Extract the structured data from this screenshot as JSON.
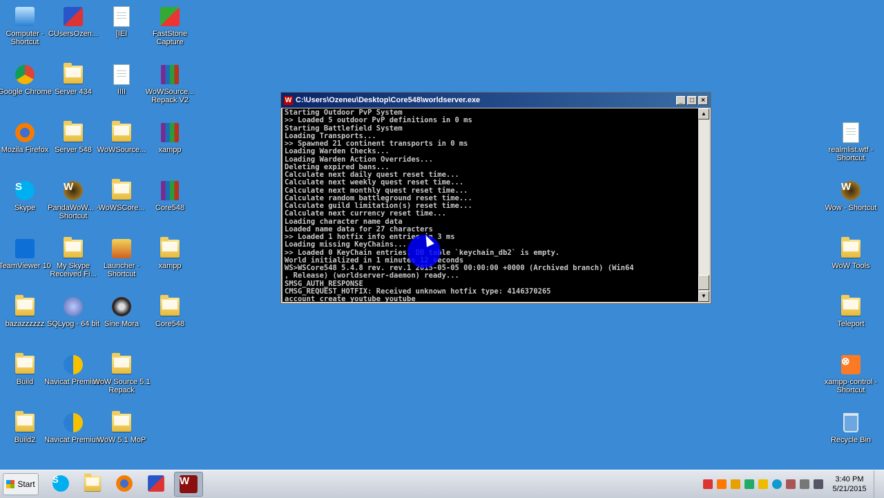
{
  "desktop_icons": [
    {
      "name": "desktop-icon-computer-shortcut",
      "label": "Computer - Shortcut",
      "icon": "computer-icon",
      "x": 0,
      "y": 0
    },
    {
      "name": "desktop-icon-cusersozen",
      "label": "CUsersOzen...",
      "icon": "triangle-app-icon"
    },
    {
      "name": "desktop-icon-iei",
      "label": "[IEI",
      "icon": "document-icon"
    },
    {
      "name": "desktop-icon-faststone",
      "label": "FastStone Capture",
      "icon": "faststone-icon"
    },
    {
      "name": "desktop-icon-google-chrome",
      "label": "Google Chrome",
      "icon": "chrome-icon"
    },
    {
      "name": "desktop-icon-server-434",
      "label": "Server 434",
      "icon": "folder-icon"
    },
    {
      "name": "desktop-icon-iiii",
      "label": "IIII",
      "icon": "document-icon"
    },
    {
      "name": "desktop-icon-wowsource-repack",
      "label": "WoWSource... Repack V2",
      "icon": "archive-icon"
    },
    {
      "name": "desktop-icon-firefox",
      "label": "Mozila Firefox",
      "icon": "firefox-icon"
    },
    {
      "name": "desktop-icon-server-548",
      "label": "Server 548",
      "icon": "folder-icon"
    },
    {
      "name": "desktop-icon-wowsource",
      "label": "WoWSource...",
      "icon": "folder-icon"
    },
    {
      "name": "desktop-icon-xampp-archive",
      "label": "xampp",
      "icon": "archive-icon"
    },
    {
      "name": "desktop-icon-skype",
      "label": "Skype",
      "icon": "skype-icon"
    },
    {
      "name": "desktop-icon-pandawow",
      "label": "PandaWoW... - Shortcut",
      "icon": "wow-icon"
    },
    {
      "name": "desktop-icon-wowscore",
      "label": "WoWSCore...",
      "icon": "folder-icon"
    },
    {
      "name": "desktop-icon-core548-archive",
      "label": "Core548",
      "icon": "archive-icon"
    },
    {
      "name": "desktop-icon-teamviewer",
      "label": "TeamViewer 10",
      "icon": "teamviewer-icon"
    },
    {
      "name": "desktop-icon-my-skype-received",
      "label": "My Skype Received Fi...",
      "icon": "folder-icon"
    },
    {
      "name": "desktop-icon-launcher",
      "label": "Launcher - Shortcut",
      "icon": "launcher-icon"
    },
    {
      "name": "desktop-icon-xampp-folder",
      "label": "xampp",
      "icon": "folder-icon"
    },
    {
      "name": "desktop-icon-bazazzzzz",
      "label": "bazazzzzzz",
      "icon": "folder-icon"
    },
    {
      "name": "desktop-icon-sqlyog",
      "label": "SQLyog - 64 bit",
      "icon": "sqlyog-icon"
    },
    {
      "name": "desktop-icon-sine-mora",
      "label": "Sine Mora",
      "icon": "sinemora-icon"
    },
    {
      "name": "desktop-icon-core548-folder",
      "label": "Core548",
      "icon": "folder-icon"
    },
    {
      "name": "desktop-icon-build",
      "label": "Build",
      "icon": "folder-icon"
    },
    {
      "name": "desktop-icon-navicat-1",
      "label": "Navicat Premium",
      "icon": "navicat-icon"
    },
    {
      "name": "desktop-icon-wow-source-51",
      "label": "WoW Source 5.1 Repack",
      "icon": "folder-icon"
    },
    {
      "name": "desktop-icon-build2",
      "label": "Build2",
      "icon": "folder-icon"
    },
    {
      "name": "desktop-icon-navicat-2",
      "label": "Navicat Premium",
      "icon": "navicat-icon"
    },
    {
      "name": "desktop-icon-wow-51-mop",
      "label": "WoW 5.1 MoP",
      "icon": "folder-icon"
    },
    {
      "name": "desktop-icon-realmlist",
      "label": "realmlist.wtf - Shortcut",
      "icon": "document-icon"
    },
    {
      "name": "desktop-icon-wow-shortcut",
      "label": "Wow - Shortcut",
      "icon": "wow-icon"
    },
    {
      "name": "desktop-icon-wow-tools",
      "label": "WoW Tools",
      "icon": "folder-icon"
    },
    {
      "name": "desktop-icon-teleport",
      "label": "Teleport",
      "icon": "folder-icon"
    },
    {
      "name": "desktop-icon-xampp-control",
      "label": "xampp-control - Shortcut",
      "icon": "xampp-icon"
    },
    {
      "name": "desktop-icon-recycle-bin",
      "label": "Recycle Bin",
      "icon": "recycle-bin-icon"
    }
  ],
  "console_window": {
    "title": "C:\\Users\\Ozeneu\\Desktop\\Core548\\worldserver.exe",
    "minimize": "_",
    "maximize": "□",
    "close": "×",
    "lines": [
      "Starting Outdoor PvP System",
      ">> Loaded 5 outdoor PvP definitions in 0 ms",
      "Starting Battlefield System",
      "Loading Transports...",
      ">> Spawned 21 continent transports in 0 ms",
      "Loading Warden Checks...",
      "Loading Warden Action Overrides...",
      "Deleting expired bans...",
      "Calculate next daily quest reset time...",
      "Calculate next weekly quest reset time...",
      "Calculate next monthly quest reset time...",
      "Calculate random battleground reset time...",
      "Calculate guild limitation(s) reset time...",
      "Calculate next currency reset time...",
      "Loading character name data",
      "Loaded name data for 27 characters",
      ">> Loaded 1 hotfix info entries in 3 ms",
      "Loading missing KeyChains...",
      ">> Loaded 0 KeyChain entries. DB table `keychain_db2` is empty.",
      "World initialized in 1 minutes 12 seconds",
      "WS>WSCore548 5.4.8 rev. rev.1 2015-05-05 00:00:00 +0000 (Archived branch) (Win64",
      ", Release) (worldserver-daemon) ready...",
      "SMSG_AUTH_RESPONSE",
      "CMSG_REQUEST_HOTFIX: Received unknown hotfix type: 4146370265",
      "account create youtube youtube_"
    ]
  },
  "taskbar": {
    "start_label": "Start",
    "buttons": [
      {
        "name": "taskbar-skype",
        "icon": "skype-icon"
      },
      {
        "name": "taskbar-explorer",
        "icon": "folder-icon"
      },
      {
        "name": "taskbar-firefox",
        "icon": "firefox-icon"
      },
      {
        "name": "taskbar-app-a",
        "icon": "triangle-app-icon"
      },
      {
        "name": "taskbar-worldserver",
        "icon": "worldserver-icon",
        "active": true
      }
    ],
    "clock_time": "3:40 PM",
    "clock_date": "5/21/2015"
  },
  "colors": {
    "desktop": "#3a8ad6",
    "console_bg": "#000000",
    "console_fg": "#c8c8c8",
    "titlebar": "#0a246a"
  }
}
